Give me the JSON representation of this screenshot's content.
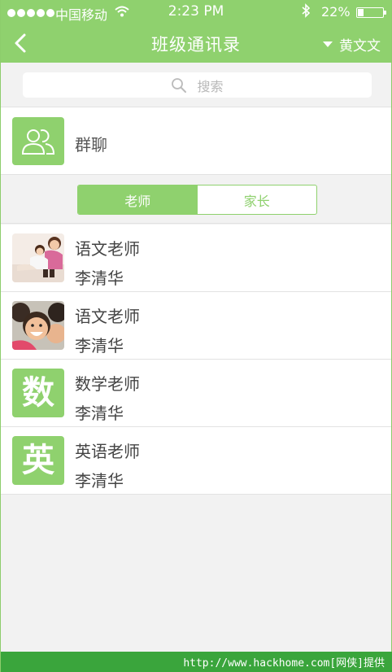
{
  "status": {
    "carrier": "中国移动",
    "time": "2:23 PM",
    "battery": "22%",
    "battery_level": 0.22
  },
  "nav": {
    "title": "班级通讯录",
    "user": "黄文文"
  },
  "search": {
    "placeholder": "搜索"
  },
  "group": {
    "label": "群聊"
  },
  "tabs": [
    {
      "label": "老师",
      "active": true
    },
    {
      "label": "家长",
      "active": false
    }
  ],
  "contacts": [
    {
      "role": "语文老师",
      "name": "李清华",
      "avatar": "photo-mother-child"
    },
    {
      "role": "语文老师",
      "name": "李清华",
      "avatar": "photo-smiling-kids"
    },
    {
      "role": "数学老师",
      "name": "李清华",
      "avatar": "数"
    },
    {
      "role": "英语老师",
      "name": "李清华",
      "avatar": "英"
    }
  ],
  "footer": {
    "credit": "http://www.hackhome.com[网侠]提供"
  },
  "colors": {
    "accent": "#8fd16e",
    "footer": "#3aa53c"
  }
}
